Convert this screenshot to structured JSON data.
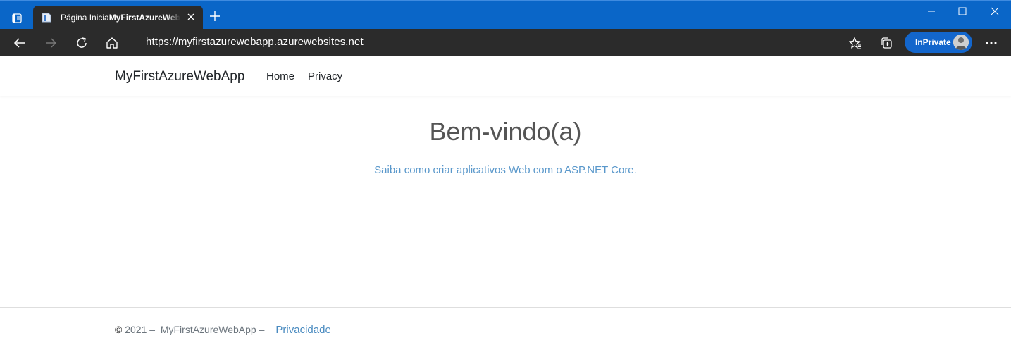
{
  "browser": {
    "tab_title": "Página Inicial - MyFirstAzureWebApp",
    "tab_title_prefix": "Página Inicia",
    "tab_title_bold": "MyFirstAzureWebApp",
    "address_url": "https://myfirstazurewebapp.azurewebsites.net",
    "inprivate_label": "InPrivate",
    "colors": {
      "titlebar": "#0a66c8",
      "toolbar": "#2b2b2b",
      "inprivate": "#1366cc"
    }
  },
  "site": {
    "brand": "MyFirstAzureWebApp",
    "nav": [
      {
        "label": "Home"
      },
      {
        "label": "Privacy"
      }
    ]
  },
  "main": {
    "heading": "Bem-vindo(a)",
    "learn_link": "Saiba como criar aplicativos Web com o ASP.NET Core."
  },
  "footer": {
    "copyright_symbol": "©",
    "year_text": " 2021 –  ",
    "app_name": "MyFirstAzureWebApp –",
    "privacy_link": "Privacidade"
  }
}
